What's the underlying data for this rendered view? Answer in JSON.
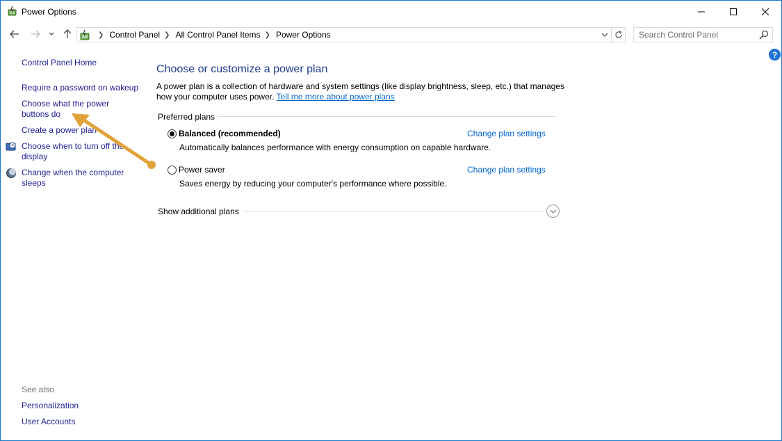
{
  "window": {
    "title": "Power Options",
    "controls": {
      "minimize": "—",
      "maximize": "☐",
      "close": "✕"
    }
  },
  "nav": {
    "breadcrumbs": [
      "Control Panel",
      "All Control Panel Items",
      "Power Options"
    ],
    "search_placeholder": "Search Control Panel"
  },
  "help": {
    "label": "?"
  },
  "leftpane": {
    "home": "Control Panel Home",
    "links": [
      "Require a password on wakeup",
      "Choose what the power buttons do",
      "Create a power plan",
      "Choose when to turn off the display",
      "Change when the computer sleeps"
    ],
    "see_also_label": "See also",
    "see_also": [
      "Personalization",
      "User Accounts"
    ]
  },
  "main": {
    "title": "Choose or customize a power plan",
    "description": "A power plan is a collection of hardware and system settings (like display brightness, sleep, etc.) that manages how your computer uses power.",
    "description_link": "Tell me more about power plans",
    "preferred_label": "Preferred plans",
    "plans": [
      {
        "name": "Balanced (recommended)",
        "selected": true,
        "description": "Automatically balances performance with energy consumption on capable hardware.",
        "link": "Change plan settings"
      },
      {
        "name": "Power saver",
        "selected": false,
        "description": "Saves energy by reducing your computer's performance where possible.",
        "link": "Change plan settings"
      }
    ],
    "additional_label": "Show additional plans"
  },
  "colors": {
    "link": "#0066cc",
    "nav_link": "#1d1d8f",
    "title": "#1e3d8f",
    "window_border": "#1979ca",
    "annotation_arrow": "#e3a33b"
  }
}
